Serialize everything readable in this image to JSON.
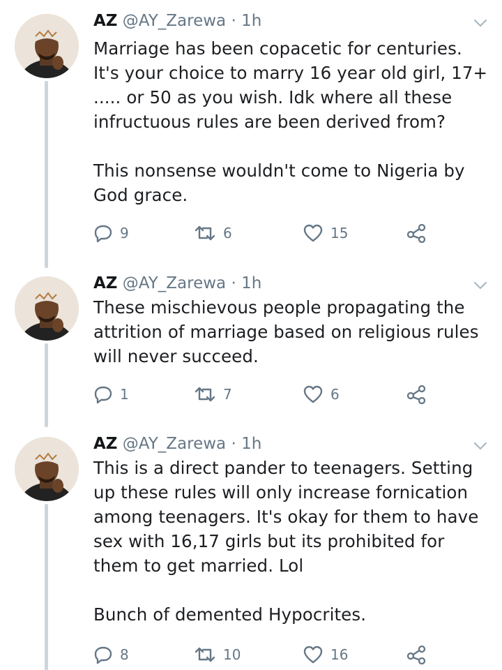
{
  "tweets": [
    {
      "name": "AZ",
      "handle": "@AY_Zarewa",
      "time": "· 1h",
      "text": "Marriage has been copacetic for centuries. It's your choice to marry 16 year old girl, 17+ ..... or 50 as you wish. Idk where all these infructuous rules are been derived from?\n\nThis nonsense wouldn't come to Nigeria by God grace.",
      "replies": "9",
      "retweets": "6",
      "likes": "15"
    },
    {
      "name": "AZ",
      "handle": "@AY_Zarewa",
      "time": "· 1h",
      "text": "These mischievous people propagating the attrition of marriage based on religious rules will never succeed.",
      "replies": "1",
      "retweets": "7",
      "likes": "6"
    },
    {
      "name": "AZ",
      "handle": "@AY_Zarewa",
      "time": "· 1h",
      "text": "This is a direct pander to teenagers. Setting up these rules will only increase fornication among teenagers. It's okay for them to have sex with 16,17 girls but its prohibited for them to get married. Lol\n\nBunch of demented Hypocrites.",
      "replies": "8",
      "retweets": "10",
      "likes": "16"
    }
  ],
  "icons": {
    "reply": "reply-icon",
    "retweet": "retweet-icon",
    "like": "heart-icon",
    "share": "share-icon",
    "menu": "chevron-down-icon"
  },
  "colors": {
    "text": "#14171a",
    "muted": "#657786",
    "thread_line": "#cdd5dc"
  }
}
